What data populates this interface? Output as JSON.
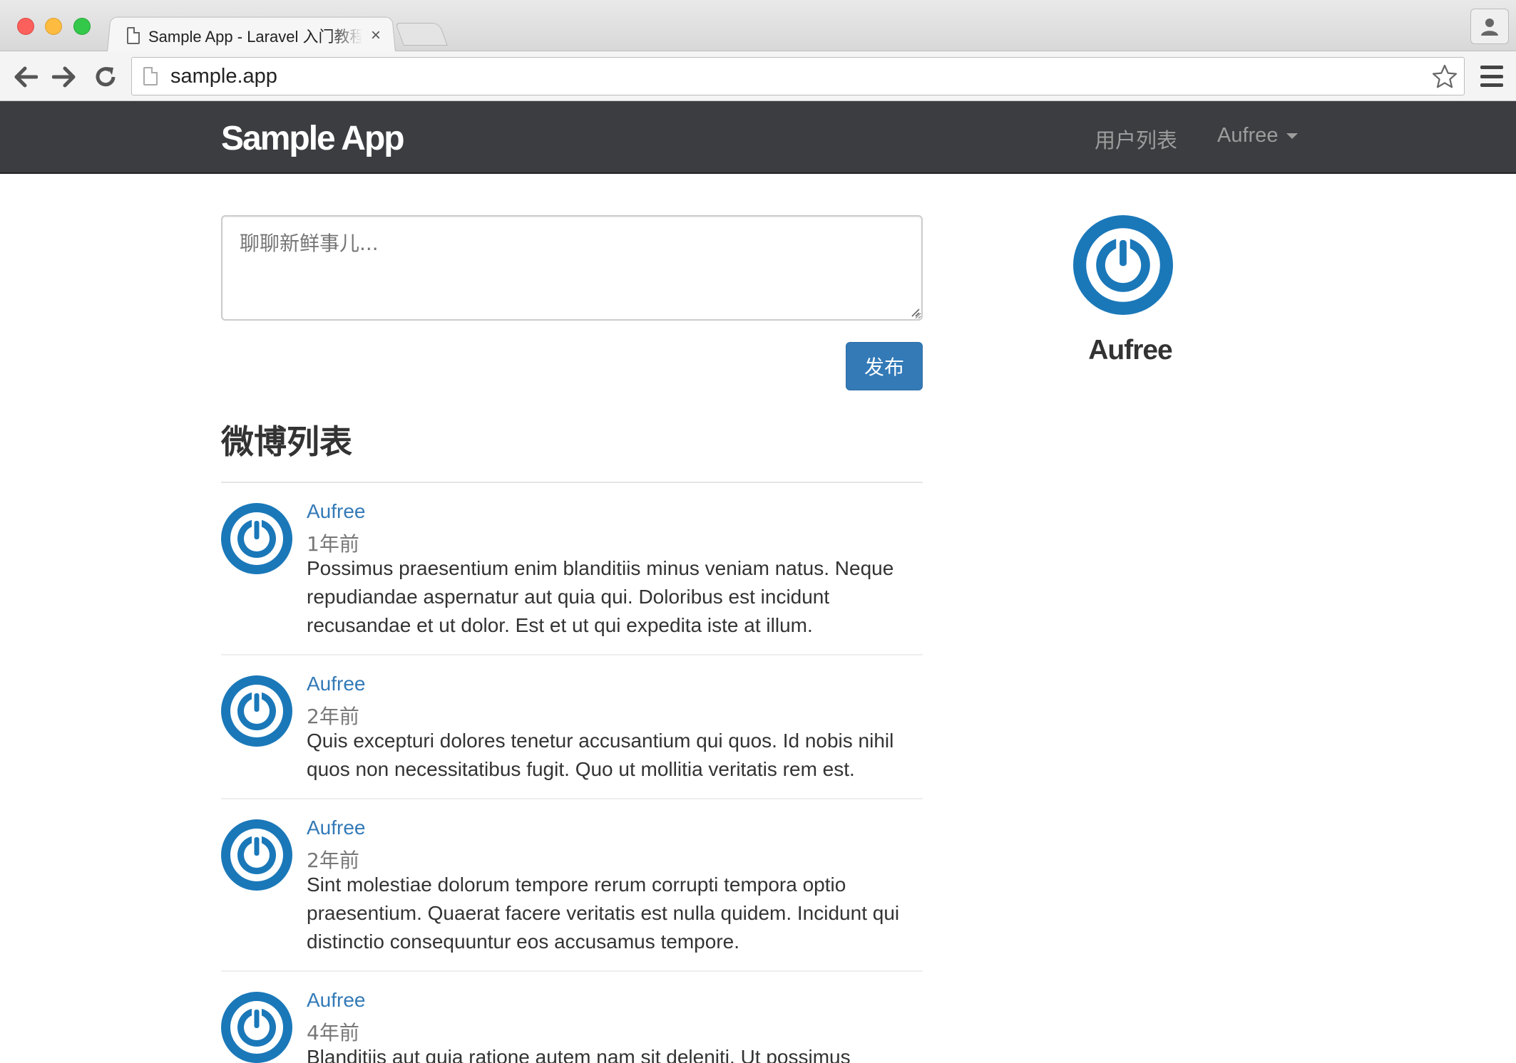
{
  "browser": {
    "tab_title": "Sample App - Laravel 入门教程",
    "tab_close": "×",
    "url": "sample.app",
    "icons": [
      "back-arrow-icon",
      "forward-arrow-icon",
      "reload-icon",
      "page-icon",
      "star-icon",
      "menu-icon",
      "profile-icon"
    ]
  },
  "navbar": {
    "brand": "Sample App",
    "users_link": "用户列表",
    "user_menu": "Aufree"
  },
  "composer": {
    "placeholder": "聊聊新鲜事儿...",
    "submit_label": "发布"
  },
  "feed": {
    "title": "微博列表",
    "items": [
      {
        "author": "Aufree",
        "time": "1年前",
        "body": "Possimus praesentium enim blanditiis minus veniam natus. Neque repudiandae aspernatur aut quia qui. Doloribus est incidunt recusandae et ut dolor. Est et ut qui expedita iste at illum."
      },
      {
        "author": "Aufree",
        "time": "2年前",
        "body": "Quis excepturi dolores tenetur accusantium qui quos. Id nobis nihil quos non necessitatibus fugit. Quo ut mollitia veritatis rem est."
      },
      {
        "author": "Aufree",
        "time": "2年前",
        "body": "Sint molestiae dolorum tempore rerum corrupti tempora optio praesentium. Quaerat facere veritatis est nulla quidem. Incidunt qui distinctio consequuntur eos accusamus tempore."
      },
      {
        "author": "Aufree",
        "time": "4年前",
        "body": "Blanditiis aut quia ratione autem nam sit deleniti. Ut possimus"
      }
    ]
  },
  "sidebar": {
    "user_name": "Aufree"
  },
  "colors": {
    "navbar_bg": "#3c3d41",
    "primary": "#337ab7",
    "avatar_blue": "#1a78b9"
  }
}
